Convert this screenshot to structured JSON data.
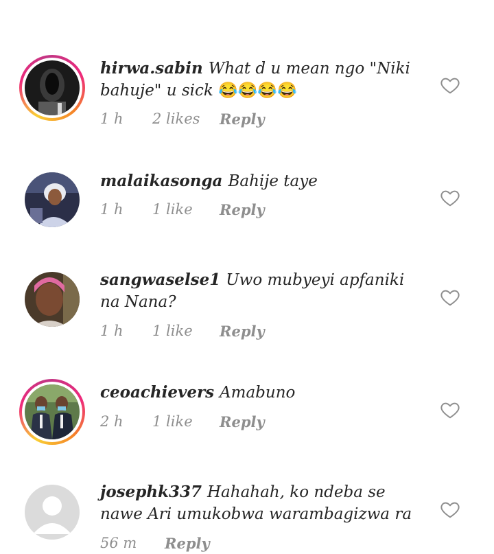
{
  "colors": {
    "text": "#262626",
    "muted": "#8e8e8e",
    "story_ring_start": "#f9ce34",
    "story_ring_mid": "#ee2a7b"
  },
  "comments": [
    {
      "username": "hirwa.sabin",
      "text": "What d u mean ngo \"Niki bahuje\" u sick",
      "emoji": "😂😂😂😂",
      "time": "1 h",
      "likes": "2 likes",
      "reply": "Reply",
      "story_ring": true,
      "avatar_icon": "dark-figure-photo",
      "like_icon": "heart-outline-icon"
    },
    {
      "username": "malaikasonga",
      "text": "Bahije taye",
      "time": "1 h",
      "likes": "1 like",
      "reply": "Reply",
      "story_ring": false,
      "avatar_icon": "woman-white-veil-photo",
      "like_icon": "heart-outline-icon"
    },
    {
      "username": "sangwaselse1",
      "text": "Uwo mubyeyi apfaniki na Nana?",
      "time": "1 h",
      "likes": "1 like",
      "reply": "Reply",
      "story_ring": false,
      "avatar_icon": "man-portrait-photo",
      "like_icon": "heart-outline-icon"
    },
    {
      "username": "ceoachievers",
      "text": "Amabuno",
      "time": "2 h",
      "likes": "1 like",
      "reply": "Reply",
      "story_ring": true,
      "avatar_icon": "two-men-suits-photo",
      "like_icon": "heart-outline-icon"
    },
    {
      "username": "josephk337",
      "text": "Hahahah, ko ndeba se nawe Ari umukobwa warambagizwa ra",
      "time": "56 m",
      "reply": "Reply",
      "story_ring": false,
      "avatar_icon": "default-avatar-icon",
      "like_icon": "heart-outline-icon"
    }
  ]
}
